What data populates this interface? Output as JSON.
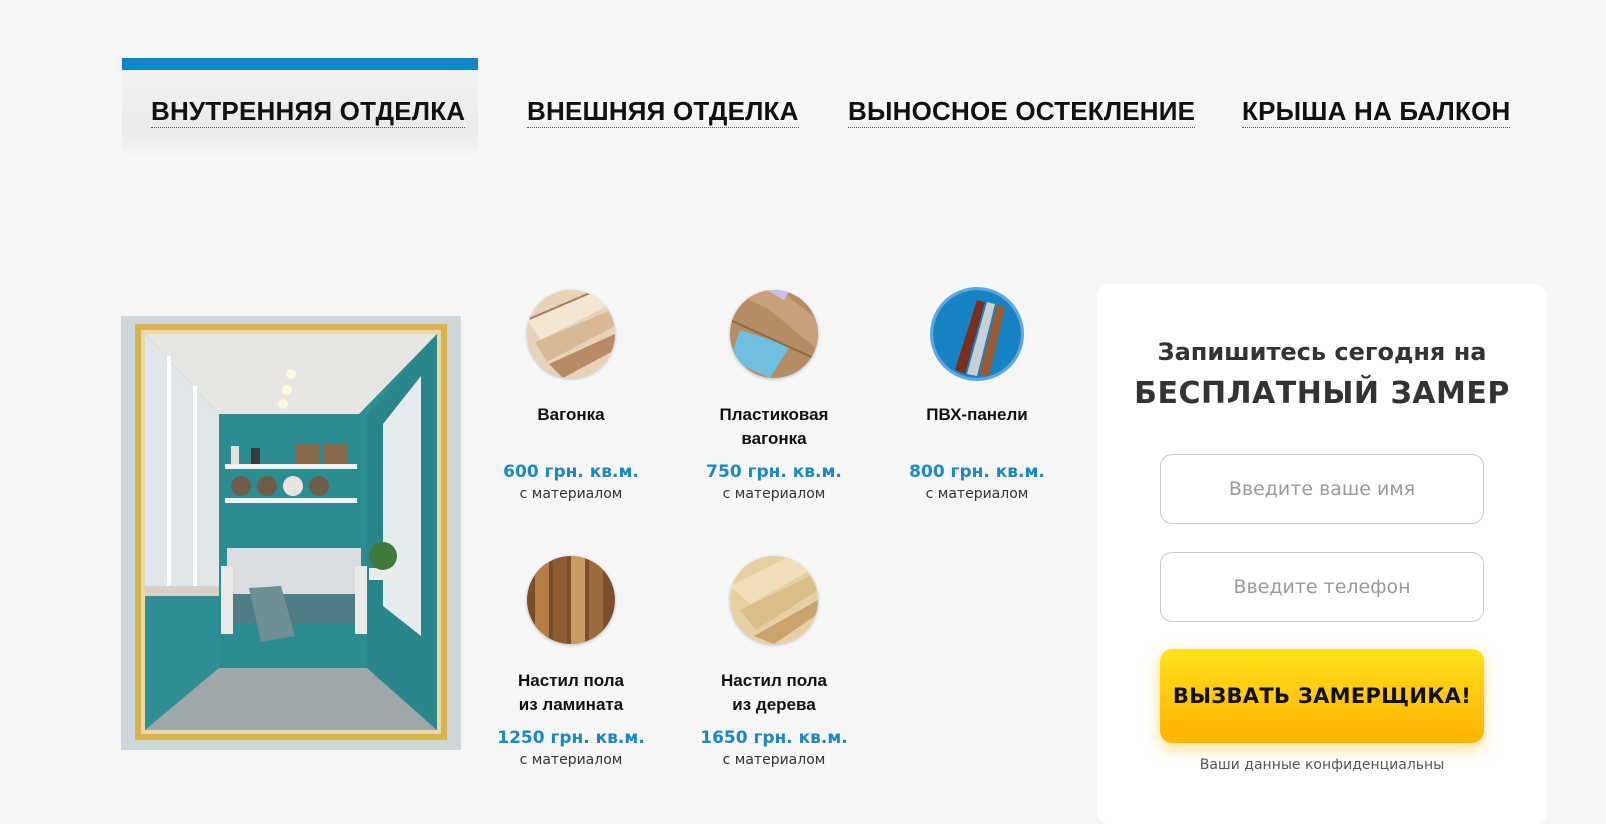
{
  "tabs": [
    {
      "label": "ВНУТРЕННЯЯ ОТДЕЛКА",
      "active": true
    },
    {
      "label": "ВНЕШНЯЯ ОТДЕЛКА",
      "active": false
    },
    {
      "label": "ВЫНОСНОЕ ОСТЕКЛЕНИЕ",
      "active": false
    },
    {
      "label": "КРЫША НА БАЛКОН",
      "active": false
    }
  ],
  "colors": {
    "accent": "#0a86c9",
    "price": "#1a87c7",
    "cta": "#ffc40c",
    "background": "#f6f6f6"
  },
  "products": [
    {
      "name": "Вагонка",
      "price": "600 грн. кв.м.",
      "note": "с материалом",
      "icon": "wood-lining-image"
    },
    {
      "name": "Пластиковая\nвагонка",
      "price": "750 грн. кв.м.",
      "note": "с материалом",
      "icon": "plastic-lining-image"
    },
    {
      "name": "ПВХ-панели",
      "price": "800 грн. кв.м.",
      "note": "с материалом",
      "icon": "pvc-panels-image"
    },
    {
      "name": "Настил пола\nиз ламината",
      "price": "1250 грн. кв.м.",
      "note": "с материалом",
      "icon": "laminate-image"
    },
    {
      "name": "Настил пола\nиз дерева",
      "price": "1650 грн. кв.м.",
      "note": "с материалом",
      "icon": "wood-floor-image"
    }
  ],
  "form": {
    "subtitle": "Запишитесь сегодня на",
    "title": "БЕСПЛАТНЫЙ ЗАМЕР",
    "name_placeholder": "Введите ваше имя",
    "phone_placeholder": "Введите телефон",
    "submit_label": "ВЫЗВАТЬ ЗАМЕРЩИКА!",
    "privacy": "Ваши данные конфиденциальны"
  }
}
